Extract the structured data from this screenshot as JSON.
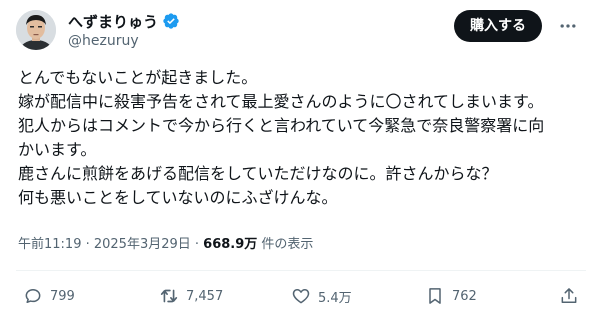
{
  "author": {
    "display_name": "へずまりゅう",
    "handle": "@hezuruy"
  },
  "header": {
    "buy_label": "購入する"
  },
  "post": {
    "lines": [
      "とんでもないことが起きました。",
      "嫁が配信中に殺害予告をされて最上愛さんのように〇されてしまいます。",
      "犯人からはコメントで今から行くと言われていて今緊急で奈良警察署に向",
      "かいます。",
      "鹿さんに煎餅をあげる配信をしていただけなのに。許さんからな？",
      "何も悪いことをしていないのにふざけんな。"
    ]
  },
  "meta": {
    "timestamp": "午前11:19 · 2025年3月29日",
    "separator": " · ",
    "views_count": "668.9万",
    "views_label": " 件の表示"
  },
  "actions": {
    "reply_count": "799",
    "repost_count": "7,457",
    "like_count": "5.4万",
    "bookmark_count": "762"
  },
  "colors": {
    "text": "#0f1419",
    "secondary": "#536471",
    "verified": "#1d9bf0",
    "button_bg": "#0f1419",
    "divider": "#eff3f4"
  },
  "icons": {
    "verified": "verified-badge-icon",
    "more": "more-dots-icon",
    "reply": "reply-bubble-icon",
    "repost": "repost-arrows-icon",
    "like": "heart-icon",
    "bookmark": "bookmark-icon",
    "share": "share-upload-icon"
  }
}
